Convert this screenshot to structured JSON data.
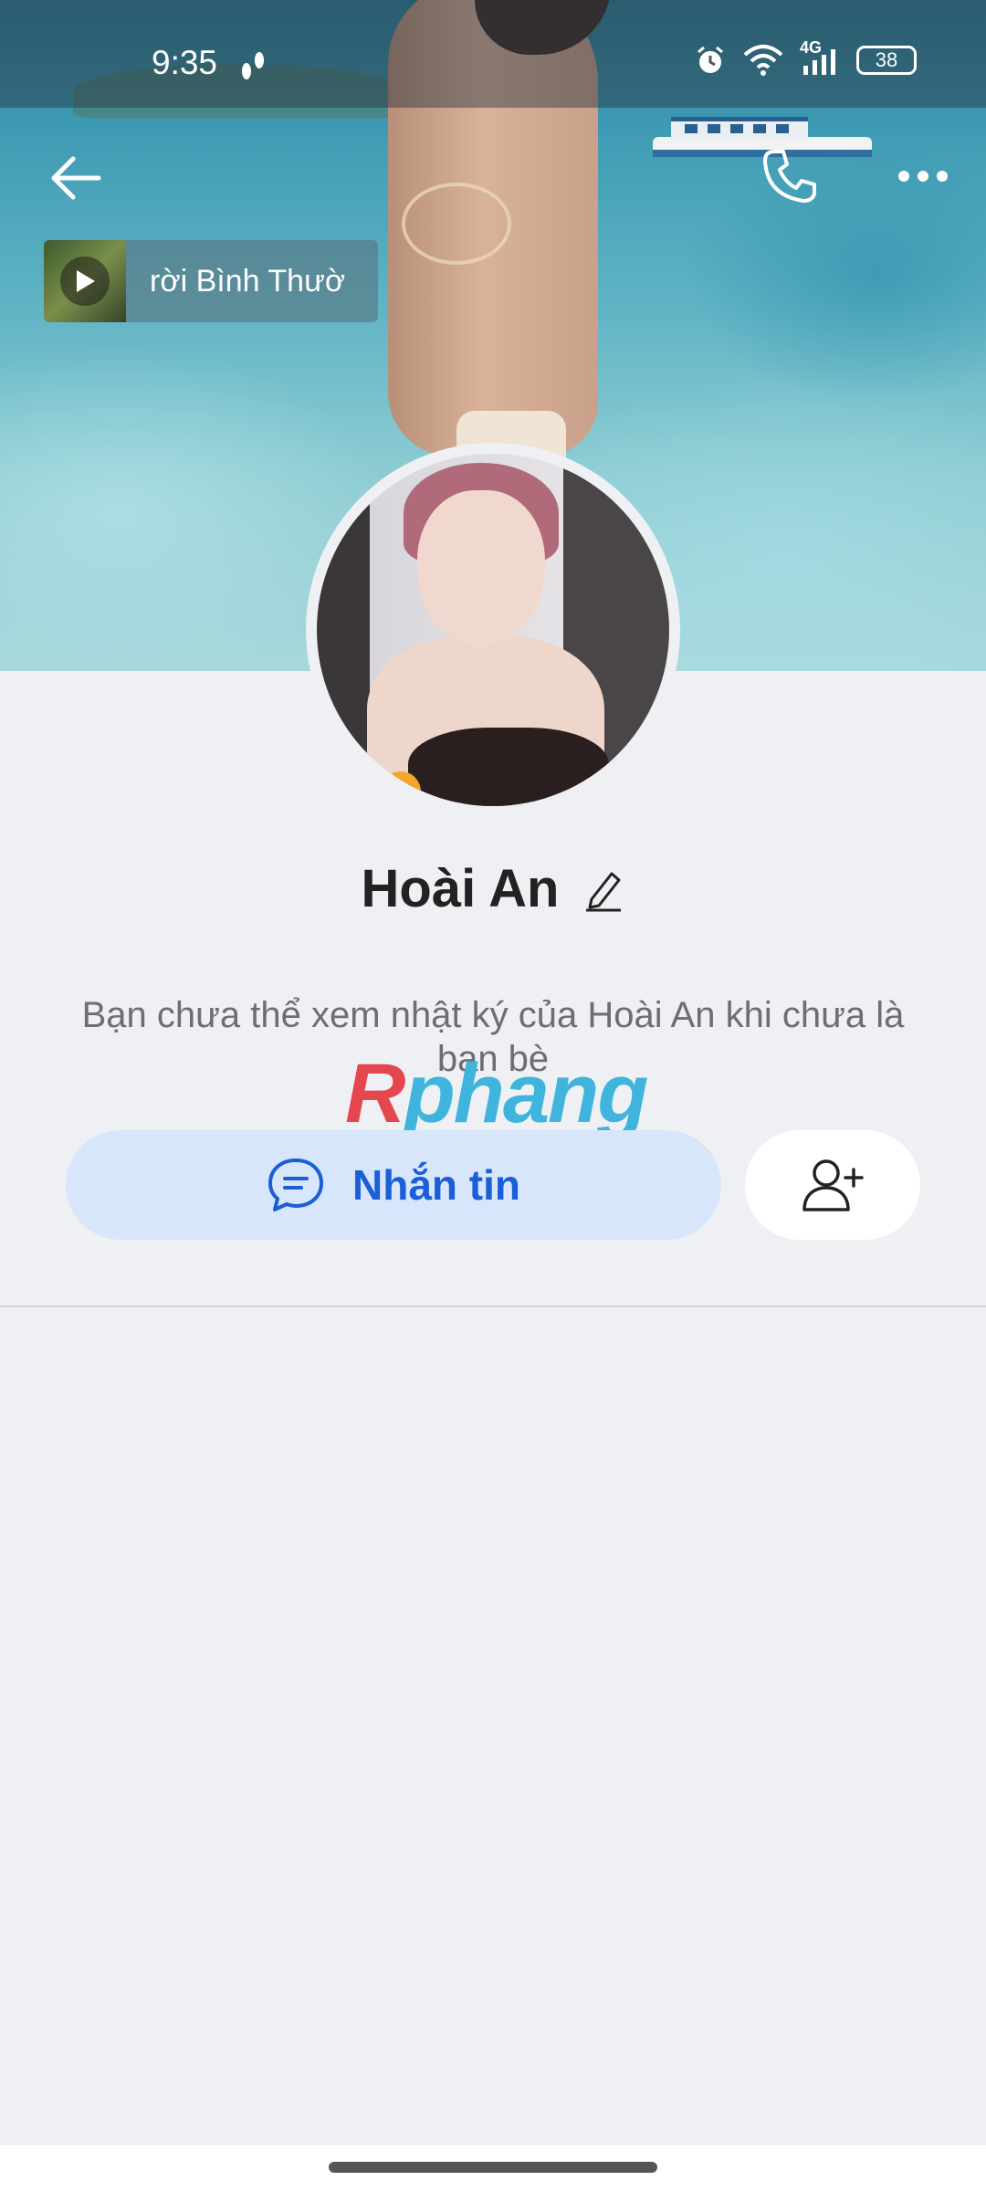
{
  "status_bar": {
    "time": "9:35",
    "network": "4G",
    "battery": "38"
  },
  "cover": {
    "music": {
      "title": "rời Bình Thườ"
    }
  },
  "profile": {
    "name": "Hoài An",
    "notice": "Bạn chưa thể xem nhật ký của Hoài An khi chưa là bạn bè"
  },
  "actions": {
    "message_label": "Nhắn tin"
  },
  "watermark": {
    "first": "R",
    "rest": "phang"
  },
  "icons": {
    "back": "arrow-left-icon",
    "call": "phone-icon",
    "more": "more-horizontal-icon",
    "play": "play-icon",
    "edit": "pencil-icon",
    "message": "chat-bubble-icon",
    "add_friend": "user-plus-icon"
  },
  "colors": {
    "accent": "#1a5fd6",
    "message_button_bg": "#d7e6fb",
    "page_bg": "#eff0f4"
  }
}
